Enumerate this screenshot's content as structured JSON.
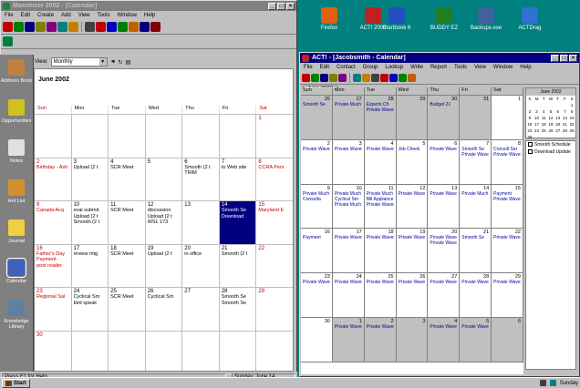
{
  "desktop_icons": [
    {
      "label": "Firefox",
      "color": "#e06010",
      "icon": "firefox-icon"
    },
    {
      "label": "ACT! 2000",
      "color": "#c02020",
      "icon": "act-icon"
    },
    {
      "label": "Startbook 6",
      "color": "#2050c0",
      "icon": "startbook-icon"
    },
    {
      "label": "BUDDY EZ",
      "color": "#208020",
      "icon": "buddy-icon"
    },
    {
      "label": "Backupx.exe",
      "color": "#4060a0",
      "icon": "backup-icon"
    },
    {
      "label": "ACTDrag",
      "color": "#3070d0",
      "icon": "actdrag-icon"
    }
  ],
  "left_window": {
    "title": "Maximizer 2002 - [Calendar]",
    "menu": [
      "File",
      "Edit",
      "Create",
      "Add",
      "View",
      "Tools",
      "Window",
      "Help"
    ],
    "view_label": "View:",
    "view_value": "Monthly",
    "month_title": "June 2002",
    "weekdays": [
      "Sun",
      "Mon",
      "Tue",
      "Wed",
      "Thu",
      "Fri",
      "Sat"
    ],
    "sidebar": [
      {
        "label": "Address Book",
        "color": "#c08040"
      },
      {
        "label": "Opportunities",
        "color": "#d0c020"
      },
      {
        "label": "Notes",
        "color": "#e0e0e0"
      },
      {
        "label": "Hot List",
        "color": "#d09030"
      },
      {
        "label": "Journal",
        "color": "#f0d040"
      },
      {
        "label": "Calendar",
        "color": "#4060c0"
      },
      {
        "label": "Knowledge Library",
        "color": "#6080a0"
      }
    ],
    "weeks": [
      [
        {
          "d": "",
          "ev": []
        },
        {
          "d": "",
          "ev": []
        },
        {
          "d": "",
          "ev": []
        },
        {
          "d": "",
          "ev": []
        },
        {
          "d": "",
          "ev": []
        },
        {
          "d": "",
          "ev": []
        },
        {
          "d": "1",
          "ev": []
        }
      ],
      [
        {
          "d": "2",
          "ev": [
            "Birthday - Ash"
          ]
        },
        {
          "d": "3",
          "ev": [
            "Upload (2 t"
          ]
        },
        {
          "d": "4",
          "ev": [
            "SCR Meet"
          ]
        },
        {
          "d": "5",
          "ev": []
        },
        {
          "d": "6",
          "ev": [
            "Smooth (2 t",
            "TRIM"
          ]
        },
        {
          "d": "7",
          "ev": [
            "to Web site"
          ]
        },
        {
          "d": "8",
          "ev": [
            "CCRA Pers"
          ]
        }
      ],
      [
        {
          "d": "9",
          "ev": [
            "Canada Acq"
          ]
        },
        {
          "d": "10",
          "ev": [
            "eval submit",
            "Upload (2 t",
            "Smooth (2 t"
          ]
        },
        {
          "d": "11",
          "ev": [
            "SCR Meet"
          ]
        },
        {
          "d": "12",
          "ev": [
            "discussion",
            "Upload (2 t",
            "WSL 173"
          ]
        },
        {
          "d": "13",
          "ev": []
        },
        {
          "d": "14",
          "ev": [
            "Smooth Se",
            "Download"
          ]
        },
        {
          "d": "15",
          "ev": [
            "Maryland E"
          ]
        }
      ],
      [
        {
          "d": "16",
          "ev": [
            "Father's Day",
            "Payment",
            "post reader"
          ]
        },
        {
          "d": "17",
          "ev": [
            "review mtg"
          ]
        },
        {
          "d": "18",
          "ev": [
            "SCR Meet"
          ]
        },
        {
          "d": "19",
          "ev": [
            "Upload (2 t"
          ]
        },
        {
          "d": "20",
          "ev": [
            "in office"
          ]
        },
        {
          "d": "21",
          "ev": [
            "Smooth (2 t"
          ]
        },
        {
          "d": "22",
          "ev": []
        }
      ],
      [
        {
          "d": "23",
          "ev": [
            "Regional Sal"
          ]
        },
        {
          "d": "24",
          "ev": [
            "Cyclical Sm",
            "bird speak"
          ]
        },
        {
          "d": "25",
          "ev": [
            "SCR Meet"
          ]
        },
        {
          "d": "26",
          "ev": [
            "Cyclical Sm"
          ]
        },
        {
          "d": "27",
          "ev": []
        },
        {
          "d": "28",
          "ev": [
            "Smooth Se",
            "Smooth Se"
          ]
        },
        {
          "d": "29",
          "ev": []
        }
      ],
      [
        {
          "d": "30",
          "ev": []
        },
        {
          "d": "",
          "ev": []
        },
        {
          "d": "",
          "ev": []
        },
        {
          "d": "",
          "ev": []
        },
        {
          "d": "",
          "ev": []
        },
        {
          "d": "",
          "ev": []
        },
        {
          "d": "",
          "ev": []
        }
      ]
    ],
    "status_left": "Press F1 for Help",
    "status_right": "Sunday, June 14"
  },
  "right_window": {
    "title": "ACT! - [Jacobsmith - Calendar]",
    "menu": [
      "File",
      "Edit",
      "Contact",
      "Group",
      "Lookup",
      "Write",
      "Report",
      "Tools",
      "View",
      "Window",
      "Help"
    ],
    "date_label": "June 2002",
    "weekdays": [
      "Sun",
      "Mon",
      "Tue",
      "Wed",
      "Thu",
      "Fri",
      "Sat"
    ],
    "weeks": [
      [
        {
          "d": "26",
          "grey": true,
          "ev": [
            "Smooth Se"
          ]
        },
        {
          "d": "27",
          "grey": true,
          "ev": [
            "Private Much"
          ]
        },
        {
          "d": "28",
          "grey": true,
          "ev": [
            "Experts Ch",
            "Private Waves"
          ]
        },
        {
          "d": "29",
          "grey": true,
          "ev": []
        },
        {
          "d": "30",
          "grey": true,
          "ev": [
            "Budget 21"
          ]
        },
        {
          "d": "31",
          "grey": true,
          "ev": []
        },
        {
          "d": "1",
          "grey": false,
          "ev": []
        }
      ],
      [
        {
          "d": "2",
          "grey": false,
          "ev": [
            "Private Waves"
          ]
        },
        {
          "d": "3",
          "grey": false,
          "ev": [
            "Private Waves"
          ]
        },
        {
          "d": "4",
          "grey": false,
          "ev": [
            "Private Waves"
          ]
        },
        {
          "d": "5",
          "grey": false,
          "ev": [
            "Job Cheek"
          ]
        },
        {
          "d": "6",
          "grey": false,
          "ev": [
            "Private Waves"
          ]
        },
        {
          "d": "7",
          "grey": false,
          "ev": [
            "Smooth Se",
            "Private Waves"
          ]
        },
        {
          "d": "8",
          "grey": false,
          "ev": [
            "Consult Ser",
            "Private Waves"
          ]
        }
      ],
      [
        {
          "d": "9",
          "grey": false,
          "ev": [
            "Private Much",
            "Consulta"
          ]
        },
        {
          "d": "10",
          "grey": false,
          "ev": [
            "Private Much",
            "Cyclical Sm",
            "Private Much"
          ]
        },
        {
          "d": "11",
          "grey": false,
          "ev": [
            "Private Much",
            "Bill Appliance",
            "Private Waves"
          ]
        },
        {
          "d": "12",
          "grey": false,
          "ev": [
            "Private Waves"
          ]
        },
        {
          "d": "13",
          "grey": false,
          "ev": [
            "Private Waves"
          ]
        },
        {
          "d": "14",
          "grey": false,
          "ev": [
            "Private Much"
          ]
        },
        {
          "d": "15",
          "grey": false,
          "ev": [
            "Payment",
            "Private Waves"
          ]
        }
      ],
      [
        {
          "d": "16",
          "grey": false,
          "ev": [
            "Payment"
          ]
        },
        {
          "d": "17",
          "grey": false,
          "ev": [
            "Private Waves"
          ]
        },
        {
          "d": "18",
          "grey": false,
          "ev": [
            "Private Waves"
          ]
        },
        {
          "d": "19",
          "grey": false,
          "ev": [
            "Private Waves"
          ]
        },
        {
          "d": "20",
          "grey": false,
          "ev": [
            "Private Waves",
            "Private Waves"
          ]
        },
        {
          "d": "21",
          "grey": false,
          "ev": [
            "Smooth Se"
          ]
        },
        {
          "d": "22",
          "grey": false,
          "ev": [
            "Private Waves"
          ]
        }
      ],
      [
        {
          "d": "23",
          "grey": false,
          "ev": [
            "Private Waves"
          ]
        },
        {
          "d": "24",
          "grey": false,
          "ev": [
            "Private Waves"
          ]
        },
        {
          "d": "25",
          "grey": false,
          "ev": [
            "Private Waves"
          ]
        },
        {
          "d": "26",
          "grey": false,
          "ev": [
            "Private Waves"
          ]
        },
        {
          "d": "27",
          "grey": false,
          "ev": [
            "Private Waves"
          ]
        },
        {
          "d": "28",
          "grey": false,
          "ev": [
            "Private Waves"
          ]
        },
        {
          "d": "29",
          "grey": false,
          "ev": [
            "Private Waves"
          ]
        }
      ],
      [
        {
          "d": "30",
          "grey": false,
          "ev": []
        },
        {
          "d": "1",
          "grey": true,
          "ev": [
            "Private Waves"
          ]
        },
        {
          "d": "2",
          "grey": true,
          "ev": [
            "Private Waves"
          ]
        },
        {
          "d": "3",
          "grey": true,
          "ev": []
        },
        {
          "d": "4",
          "grey": true,
          "ev": [
            "Private Waves"
          ]
        },
        {
          "d": "5",
          "grey": true,
          "ev": [
            "Private Waves"
          ]
        },
        {
          "d": "6",
          "grey": true,
          "ev": []
        }
      ]
    ],
    "mini_title": "June 2002",
    "mini_days": [
      "S",
      "M",
      "T",
      "W",
      "T",
      "F",
      "S"
    ],
    "mini_dates": [
      "",
      "",
      "",
      "",
      "",
      "",
      "1",
      "2",
      "3",
      "4",
      "5",
      "6",
      "7",
      "8",
      "9",
      "10",
      "11",
      "12",
      "13",
      "14",
      "15",
      "16",
      "17",
      "18",
      "19",
      "20",
      "21",
      "22",
      "23",
      "24",
      "25",
      "26",
      "27",
      "28",
      "29",
      "30",
      "",
      "",
      "",
      "",
      "",
      ""
    ],
    "todo": [
      "Smooth Schedule",
      "Download Update"
    ]
  },
  "taskbar": {
    "start_label": "Start",
    "tray_time": "Sunday"
  },
  "toolbar_colors": [
    "#c00000",
    "#008000",
    "#000080",
    "#808000",
    "#800080",
    "#008080",
    "#c08000",
    "#404040",
    "#c00000",
    "#0000c0",
    "#008000",
    "#c06000",
    "#000080",
    "#800000"
  ]
}
